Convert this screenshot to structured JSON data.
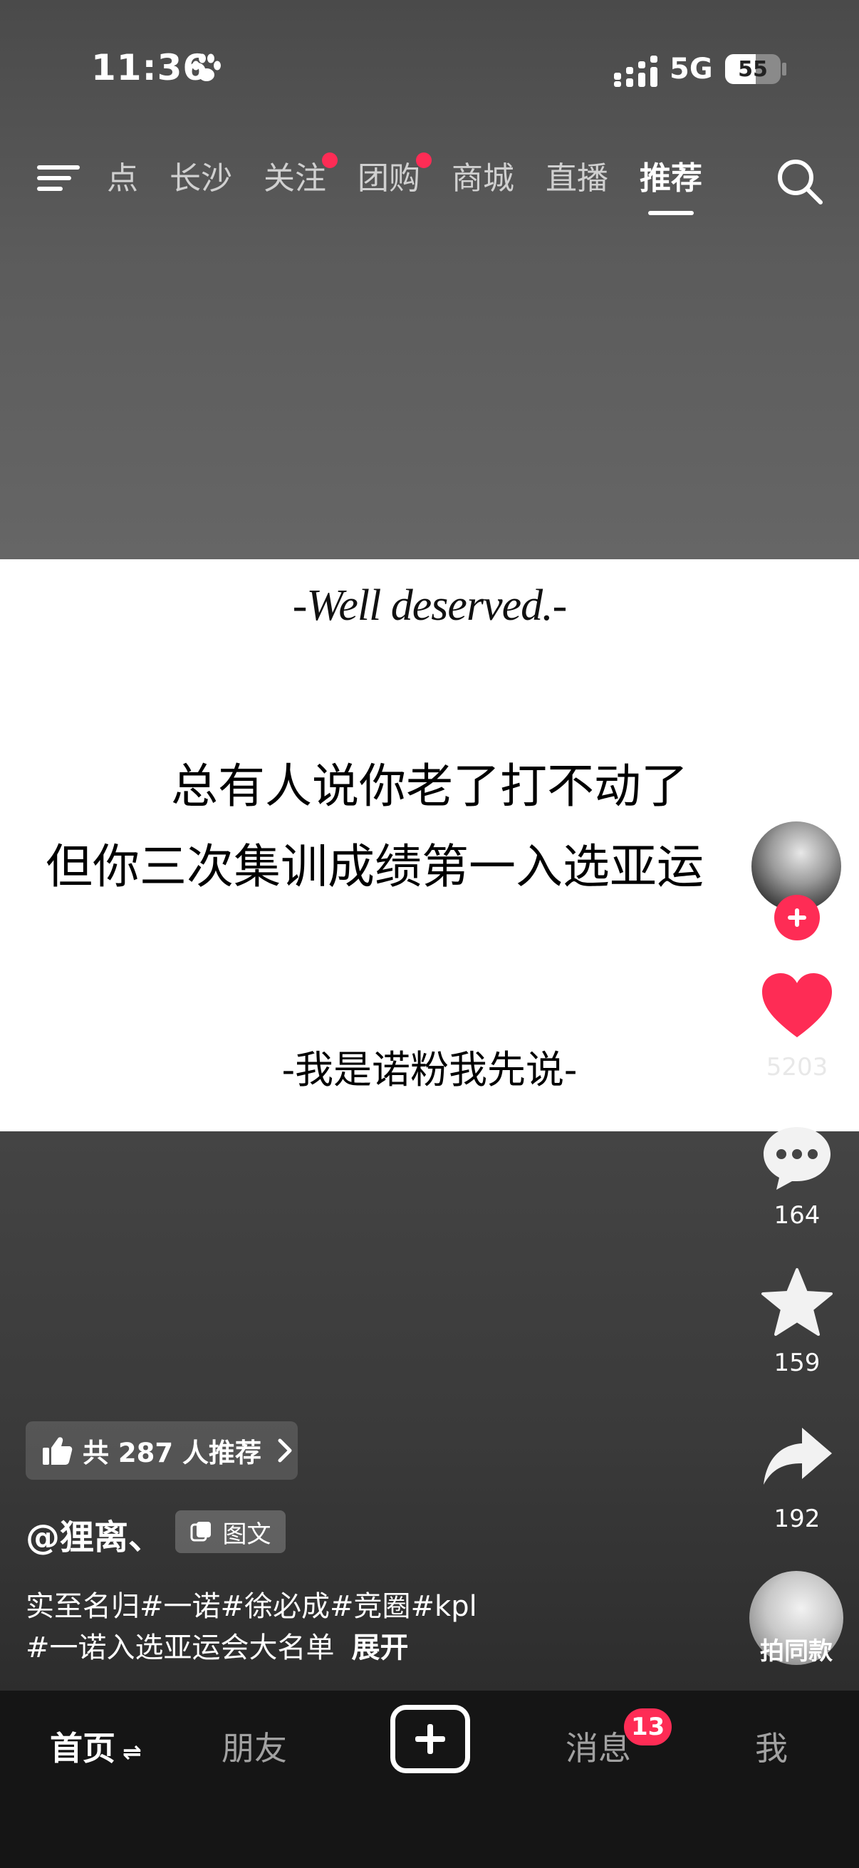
{
  "status_bar": {
    "time": "11:36",
    "network": "5G",
    "battery": "55",
    "battery_level": 0.55
  },
  "top_tabs": [
    {
      "label": "点",
      "dot": false,
      "active": false
    },
    {
      "label": "长沙",
      "dot": false,
      "active": false
    },
    {
      "label": "关注",
      "dot": true,
      "active": false
    },
    {
      "label": "团购",
      "dot": true,
      "active": false
    },
    {
      "label": "商城",
      "dot": false,
      "active": false
    },
    {
      "label": "直播",
      "dot": false,
      "active": false
    },
    {
      "label": "推荐",
      "dot": false,
      "active": true
    }
  ],
  "post_image": {
    "script_title": "-Well deserved.-",
    "line1": "总有人说你老了打不动了",
    "line2": "但你三次集训成绩第一入选亚运",
    "tagline": "-我是诺粉我先说-"
  },
  "actions": {
    "likes": "5203",
    "comments": "164",
    "favorites": "159",
    "shares": "192"
  },
  "recommend": {
    "label": "共 287 人推荐"
  },
  "author": {
    "name": "@狸离、",
    "type_badge": "图文"
  },
  "caption": {
    "line1": "实至名归#一诺#徐必成#竞圈#kpl",
    "line2": "#一诺入选亚运会大名单",
    "expand": "展开"
  },
  "music": {
    "label": "拍同款"
  },
  "bottom_nav": {
    "home": "首页",
    "home_swap": "⇌",
    "friends": "朋友",
    "messages": "消息",
    "messages_badge": "13",
    "me": "我"
  },
  "colors": {
    "accent": "#fe2c55",
    "nav_bg": "#151515"
  }
}
